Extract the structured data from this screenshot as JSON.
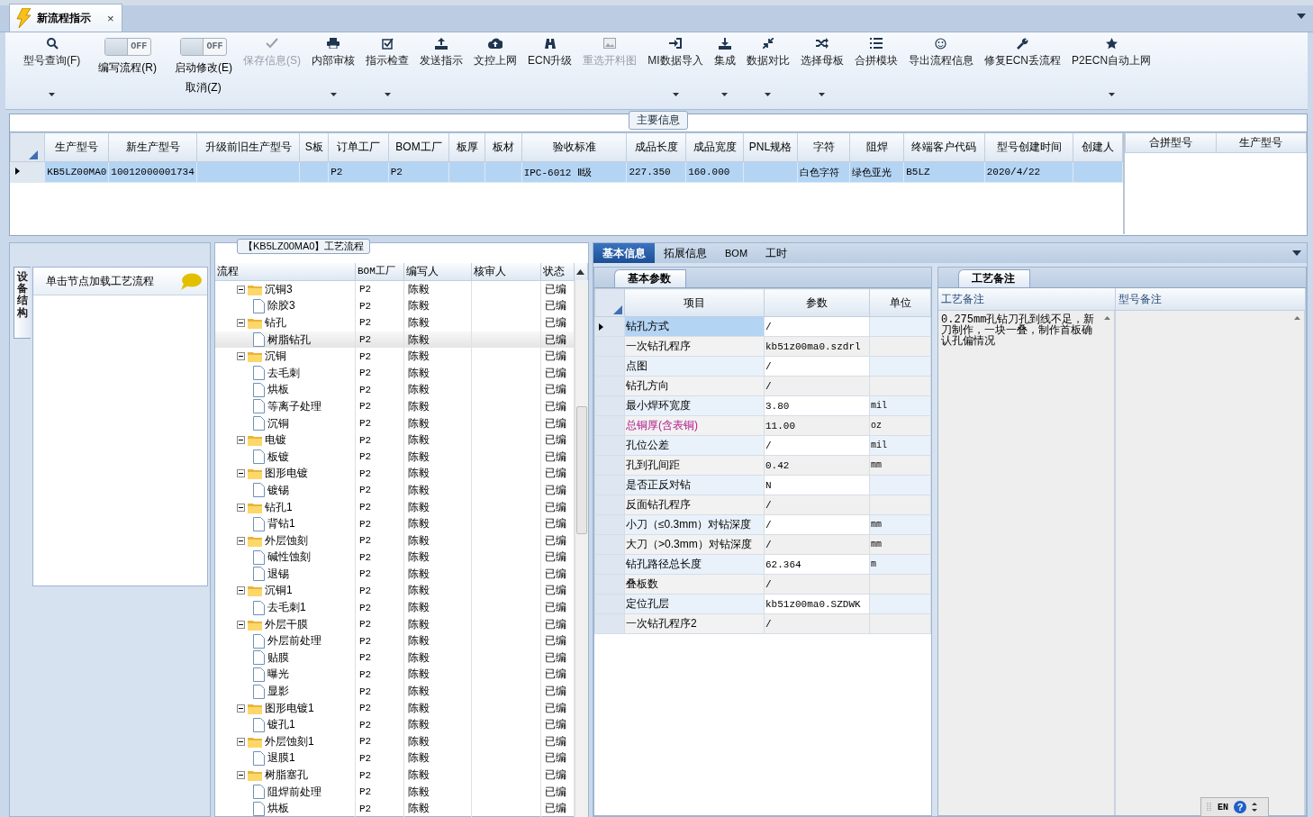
{
  "doc_tab": {
    "title": "新流程指示",
    "close": "×",
    "selected": true
  },
  "toolbar": [
    {
      "kind": "button",
      "label": "型号查询(F)",
      "dropdown": true,
      "disabled": false
    },
    {
      "kind": "toggle",
      "label": "编写流程(R)",
      "switch_text": "OFF",
      "on": false
    },
    {
      "kind": "toggle",
      "label": "启动修改(E)",
      "label2": "取消(Z)",
      "switch_text": "OFF",
      "on": false
    },
    {
      "kind": "button",
      "label": "保存信息(S)",
      "dropdown": false,
      "disabled": true
    },
    {
      "kind": "button",
      "label": "内部审核",
      "dropdown": true,
      "disabled": false
    },
    {
      "kind": "button",
      "label": "指示检查",
      "dropdown": true,
      "disabled": false
    },
    {
      "kind": "button",
      "label": "发送指示",
      "dropdown": false,
      "disabled": false
    },
    {
      "kind": "button",
      "label": "文控上网",
      "dropdown": false,
      "disabled": false
    },
    {
      "kind": "button",
      "label": "ECN升级",
      "dropdown": false,
      "disabled": false
    },
    {
      "kind": "button",
      "label": "重选开料图",
      "dropdown": false,
      "disabled": true
    },
    {
      "kind": "button",
      "label": "MI数据导入",
      "dropdown": true,
      "disabled": false
    },
    {
      "kind": "button",
      "label": "集成",
      "dropdown": true,
      "disabled": false
    },
    {
      "kind": "button",
      "label": "数据对比",
      "dropdown": true,
      "disabled": false
    },
    {
      "kind": "button",
      "label": "选择母板",
      "dropdown": true,
      "disabled": false
    },
    {
      "kind": "button",
      "label": "合拼模块",
      "dropdown": false,
      "disabled": false
    },
    {
      "kind": "button",
      "label": "导出流程信息",
      "dropdown": false,
      "disabled": false
    },
    {
      "kind": "button",
      "label": "修复ECN丢流程",
      "dropdown": false,
      "disabled": false
    },
    {
      "kind": "button",
      "label": "P2ECN自动上网",
      "dropdown": true,
      "disabled": false
    }
  ],
  "main_info": {
    "title": "主要信息",
    "columns": [
      "生产型号",
      "新生产型号",
      "升级前旧生产型号",
      "S板",
      "订单工厂",
      "BOM工厂",
      "板厚",
      "板材",
      "验收标准",
      "成品长度",
      "成品宽度",
      "PNL规格",
      "字符",
      "阻焊",
      "终端客户代码",
      "型号创建时间",
      "创建人"
    ],
    "rows": [
      {
        "selected": true,
        "cells": [
          "KB5LZ00MA0",
          "10012000001734",
          null,
          null,
          "P2",
          "P2",
          null,
          null,
          "IPC-6012 Ⅱ级",
          "227.350",
          "160.000",
          null,
          "白色字符",
          "绿色亚光",
          "B5LZ",
          "2020/4/22",
          null
        ]
      }
    ],
    "side_columns": [
      "合拼型号",
      "生产型号"
    ]
  },
  "left_panel": {
    "tab": "设备结构",
    "hint": "单击节点加载工艺流程"
  },
  "process": {
    "title": "【KB5LZ00MA0】工艺流程",
    "columns": [
      "流程",
      "BOM工厂",
      "编写人",
      "核审人",
      "状态"
    ],
    "nodes": [
      {
        "name": "沉铜3",
        "bom": "P2",
        "writer": "陈毅",
        "status": "已编",
        "expanded": true,
        "selected": false,
        "children": [
          {
            "name": "除胶3",
            "bom": "P2",
            "writer": "陈毅",
            "status": "已编",
            "selected": false
          }
        ]
      },
      {
        "name": "钻孔",
        "bom": "P2",
        "writer": "陈毅",
        "status": "已编",
        "expanded": true,
        "selected": false,
        "children": [
          {
            "name": "树脂钻孔",
            "bom": "P2",
            "writer": "陈毅",
            "status": "已编",
            "selected": true
          }
        ]
      },
      {
        "name": "沉铜",
        "bom": "P2",
        "writer": "陈毅",
        "status": "已编",
        "expanded": true,
        "selected": false,
        "children": [
          {
            "name": "去毛刺",
            "bom": "P2",
            "writer": "陈毅",
            "status": "已编",
            "selected": false
          },
          {
            "name": "烘板",
            "bom": "P2",
            "writer": "陈毅",
            "status": "已编",
            "selected": false
          },
          {
            "name": "等离子处理",
            "bom": "P2",
            "writer": "陈毅",
            "status": "已编",
            "selected": false
          },
          {
            "name": "沉铜",
            "bom": "P2",
            "writer": "陈毅",
            "status": "已编",
            "selected": false
          }
        ]
      },
      {
        "name": "电镀",
        "bom": "P2",
        "writer": "陈毅",
        "status": "已编",
        "expanded": true,
        "selected": false,
        "children": [
          {
            "name": "板镀",
            "bom": "P2",
            "writer": "陈毅",
            "status": "已编",
            "selected": false
          }
        ]
      },
      {
        "name": "图形电镀",
        "bom": "P2",
        "writer": "陈毅",
        "status": "已编",
        "expanded": true,
        "selected": false,
        "children": [
          {
            "name": "镀锡",
            "bom": "P2",
            "writer": "陈毅",
            "status": "已编",
            "selected": false
          }
        ]
      },
      {
        "name": "钻孔1",
        "bom": "P2",
        "writer": "陈毅",
        "status": "已编",
        "expanded": true,
        "selected": false,
        "children": [
          {
            "name": "背钻1",
            "bom": "P2",
            "writer": "陈毅",
            "status": "已编",
            "selected": false
          }
        ]
      },
      {
        "name": "外层蚀刻",
        "bom": "P2",
        "writer": "陈毅",
        "status": "已编",
        "expanded": true,
        "selected": false,
        "children": [
          {
            "name": "碱性蚀刻",
            "bom": "P2",
            "writer": "陈毅",
            "status": "已编",
            "selected": false
          },
          {
            "name": "退锡",
            "bom": "P2",
            "writer": "陈毅",
            "status": "已编",
            "selected": false
          }
        ]
      },
      {
        "name": "沉铜1",
        "bom": "P2",
        "writer": "陈毅",
        "status": "已编",
        "expanded": true,
        "selected": false,
        "children": [
          {
            "name": "去毛刺1",
            "bom": "P2",
            "writer": "陈毅",
            "status": "已编",
            "selected": false
          }
        ]
      },
      {
        "name": "外层干膜",
        "bom": "P2",
        "writer": "陈毅",
        "status": "已编",
        "expanded": true,
        "selected": false,
        "children": [
          {
            "name": "外层前处理",
            "bom": "P2",
            "writer": "陈毅",
            "status": "已编",
            "selected": false
          },
          {
            "name": "贴膜",
            "bom": "P2",
            "writer": "陈毅",
            "status": "已编",
            "selected": false
          },
          {
            "name": "曝光",
            "bom": "P2",
            "writer": "陈毅",
            "status": "已编",
            "selected": false
          },
          {
            "name": "显影",
            "bom": "P2",
            "writer": "陈毅",
            "status": "已编",
            "selected": false
          }
        ]
      },
      {
        "name": "图形电镀1",
        "bom": "P2",
        "writer": "陈毅",
        "status": "已编",
        "expanded": true,
        "selected": false,
        "children": [
          {
            "name": "镀孔1",
            "bom": "P2",
            "writer": "陈毅",
            "status": "已编",
            "selected": false
          }
        ]
      },
      {
        "name": "外层蚀刻1",
        "bom": "P2",
        "writer": "陈毅",
        "status": "已编",
        "expanded": true,
        "selected": false,
        "children": [
          {
            "name": "退膜1",
            "bom": "P2",
            "writer": "陈毅",
            "status": "已编",
            "selected": false
          }
        ]
      },
      {
        "name": "树脂塞孔",
        "bom": "P2",
        "writer": "陈毅",
        "status": "已编",
        "expanded": true,
        "selected": false,
        "children": [
          {
            "name": "阻焊前处理",
            "bom": "P2",
            "writer": "陈毅",
            "status": "已编",
            "selected": false
          },
          {
            "name": "烘板",
            "bom": "P2",
            "writer": "陈毅",
            "status": "已编",
            "selected": false
          }
        ]
      }
    ]
  },
  "detail_tabs": [
    {
      "label": "基本信息",
      "selected": true
    },
    {
      "label": "拓展信息",
      "selected": false
    },
    {
      "label": "BOM",
      "selected": false
    },
    {
      "label": "工时",
      "selected": false
    }
  ],
  "params": {
    "tab": "基本参数",
    "columns": [
      "项目",
      "参数",
      "单位"
    ],
    "rows": [
      {
        "item": "钻孔方式",
        "value": "/",
        "unit": null,
        "selected": true,
        "emphasis": false
      },
      {
        "item": "一次钻孔程序",
        "value": "kb51z00ma0.szdrl",
        "unit": null,
        "selected": false,
        "emphasis": false
      },
      {
        "item": "点图",
        "value": "/",
        "unit": null,
        "selected": false,
        "emphasis": false
      },
      {
        "item": "钻孔方向",
        "value": "/",
        "unit": null,
        "selected": false,
        "emphasis": false
      },
      {
        "item": "最小焊环宽度",
        "value": "3.80",
        "unit": "mil",
        "selected": false,
        "emphasis": false
      },
      {
        "item": "总铜厚(含表铜)",
        "value": "11.00",
        "unit": "oz",
        "selected": false,
        "emphasis": true
      },
      {
        "item": "孔位公差",
        "value": "/",
        "unit": "mil",
        "selected": false,
        "emphasis": false
      },
      {
        "item": "孔到孔间距",
        "value": "0.42",
        "unit": "mm",
        "selected": false,
        "emphasis": false
      },
      {
        "item": "是否正反对钻",
        "value": "N",
        "unit": null,
        "selected": false,
        "emphasis": false
      },
      {
        "item": "反面钻孔程序",
        "value": "/",
        "unit": null,
        "selected": false,
        "emphasis": false
      },
      {
        "item": "小刀（≤0.3mm）对钻深度",
        "value": "/",
        "unit": "mm",
        "selected": false,
        "emphasis": false
      },
      {
        "item": "大刀（>0.3mm）对钻深度",
        "value": "/",
        "unit": "mm",
        "selected": false,
        "emphasis": false
      },
      {
        "item": "钻孔路径总长度",
        "value": "62.364",
        "unit": "m",
        "selected": false,
        "emphasis": false
      },
      {
        "item": "叠板数",
        "value": "/",
        "unit": null,
        "selected": false,
        "emphasis": false
      },
      {
        "item": "定位孔层",
        "value": "kb51z00ma0.SZDWK",
        "unit": null,
        "selected": false,
        "emphasis": false
      },
      {
        "item": "一次钻孔程序2",
        "value": "/",
        "unit": null,
        "selected": false,
        "emphasis": false
      }
    ]
  },
  "remarks": {
    "tab": "工艺备注",
    "columns": [
      "工艺备注",
      "型号备注"
    ],
    "process_note": "0.275mm孔钻刀孔到线不足，新刀制作，一块一叠，制作首板确认孔偏情况"
  },
  "language_bar": {
    "language": "EN",
    "help": "?"
  }
}
